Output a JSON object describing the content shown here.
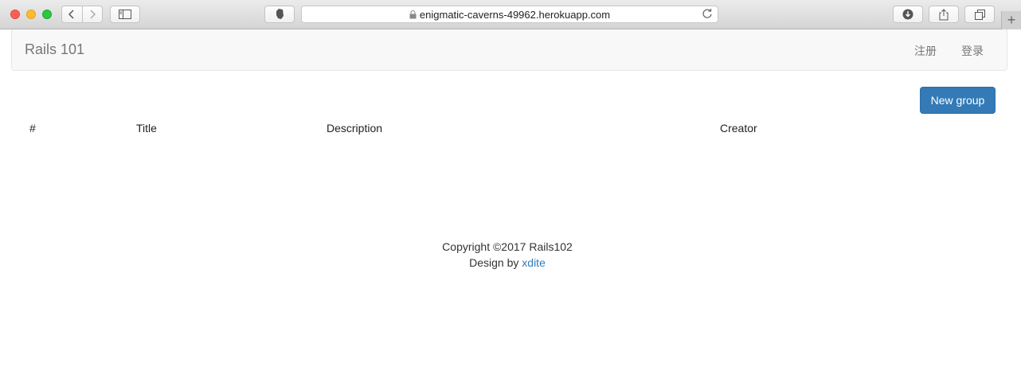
{
  "browser": {
    "url": "enigmatic-caverns-49962.herokuapp.com",
    "new_tab": "+"
  },
  "navbar": {
    "brand": "Rails 101",
    "register": "注册",
    "login": "登录"
  },
  "actions": {
    "new_group": "New group"
  },
  "table": {
    "headers": [
      "#",
      "Title",
      "Description",
      "Creator"
    ],
    "rows": []
  },
  "footer": {
    "copyright": "Copyright ©2017 Rails102",
    "design_by": "Design by",
    "author": "xdite"
  },
  "colors": {
    "primary": "#337ab7",
    "navbar_bg": "#f8f8f8"
  }
}
